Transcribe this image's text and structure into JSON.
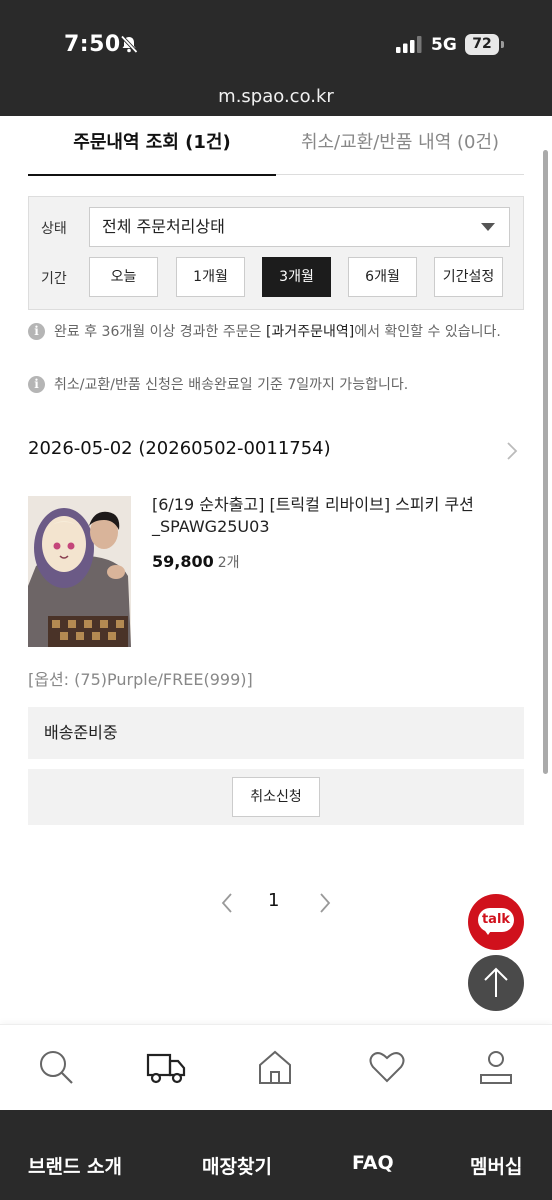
{
  "status_bar": {
    "time": "7:50",
    "network": "5G",
    "battery": "72"
  },
  "browser": {
    "url": "m.spao.co.kr"
  },
  "tabs": [
    {
      "label": "주문내역 조회 (1건)",
      "active": true
    },
    {
      "label": "취소/교환/반품 내역 (0건)",
      "active": false
    }
  ],
  "filter": {
    "status_label": "상태",
    "status_value": "전체 주문처리상태",
    "period_label": "기간",
    "periods": [
      "오늘",
      "1개월",
      "3개월",
      "6개월",
      "기간설정"
    ],
    "selected_period": "3개월"
  },
  "notices": {
    "first_prefix": "완료 후 36개월 이상 경과한 주문은 ",
    "first_emphasis": "[과거주문내역]",
    "first_suffix": "에서 확인할 수 있습니다.",
    "second": "취소/교환/반품 신청은 배송완료일 기준 7일까지 가능합니다."
  },
  "order": {
    "header": "2026-05-02 (20260502-0011754)",
    "product_name": "[6/19 순차출고] [트릭컬 리바이브] 스피키 쿠션_SPAWG25U03",
    "price": "59,800",
    "quantity": "2개",
    "option": "[옵션: (75)Purple/FREE(999)]",
    "shipping_status": "배송준비중",
    "cancel_label": "취소신청"
  },
  "pagination": {
    "current": "1"
  },
  "floating": {
    "talk_label": "talk"
  },
  "bottom_nav": [
    "search-icon",
    "truck-icon",
    "home-icon",
    "heart-icon",
    "user-icon"
  ],
  "footer": {
    "links": [
      "브랜드 소개",
      "매장찾기",
      "FAQ",
      "멤버십"
    ]
  },
  "colors": {
    "accent": "#d0111c",
    "dark": "#2a2a2a",
    "panel": "#f2f2f2"
  }
}
